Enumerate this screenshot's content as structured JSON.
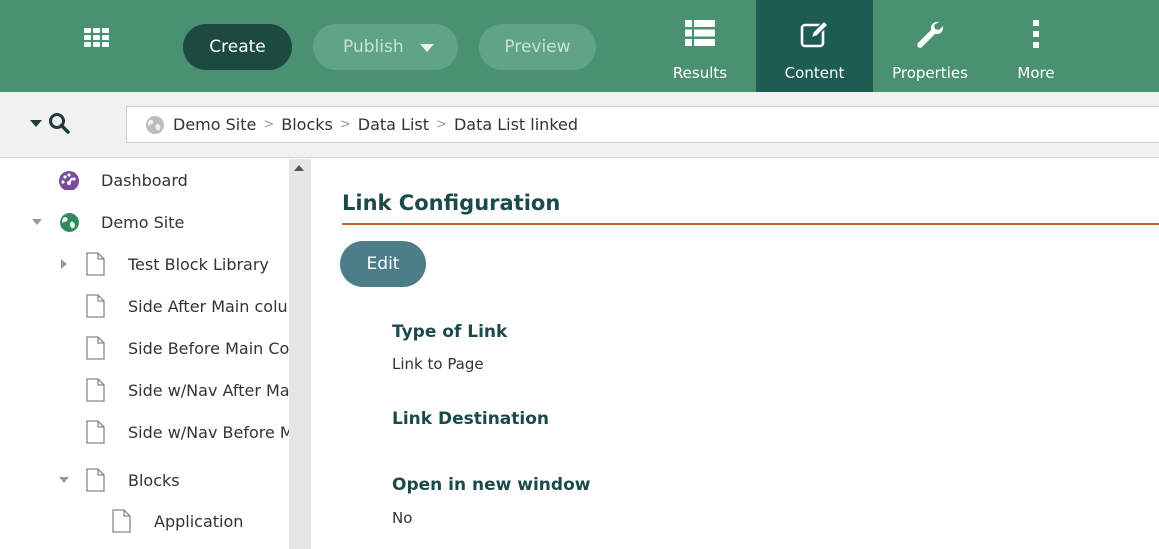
{
  "toolbar": {
    "apps_icon": "apps-grid-icon",
    "create_label": "Create",
    "publish_label": "Publish",
    "preview_label": "Preview",
    "results_label": "Results",
    "content_label": "Content",
    "properties_label": "Properties",
    "more_label": "More",
    "colors": {
      "bar": "#4a9172",
      "active_tab": "#1c5c53",
      "create": "#1d4a40",
      "disabled_pill": "#5fa486"
    }
  },
  "breadcrumb": {
    "items": [
      "Demo Site",
      "Blocks",
      "Data List",
      "Data List linked"
    ]
  },
  "tree": {
    "items": [
      {
        "label": "Dashboard",
        "icon": "dashboard-icon"
      },
      {
        "label": "Demo Site",
        "icon": "globe-icon",
        "expander": "expanded"
      },
      {
        "label": "Test Block Library",
        "icon": "page-icon",
        "expander": "collapsed"
      },
      {
        "label": "Side After Main colu",
        "icon": "page-icon"
      },
      {
        "label": "Side Before Main Co",
        "icon": "page-icon"
      },
      {
        "label": "Side w/Nav After Ma",
        "icon": "page-icon"
      },
      {
        "label": "Side w/Nav Before M",
        "icon": "page-icon"
      },
      {
        "label": "Blocks",
        "icon": "page-icon",
        "expander": "expanded"
      },
      {
        "label": "Application",
        "icon": "page-icon"
      }
    ]
  },
  "main": {
    "heading": "Link Configuration",
    "edit_label": "Edit",
    "fields": [
      {
        "label": "Type of Link",
        "value": "Link to Page"
      },
      {
        "label": "Link Destination",
        "value": ""
      },
      {
        "label": "Open in new window",
        "value": "No"
      }
    ],
    "accent_rule_color": "#b5662d"
  }
}
